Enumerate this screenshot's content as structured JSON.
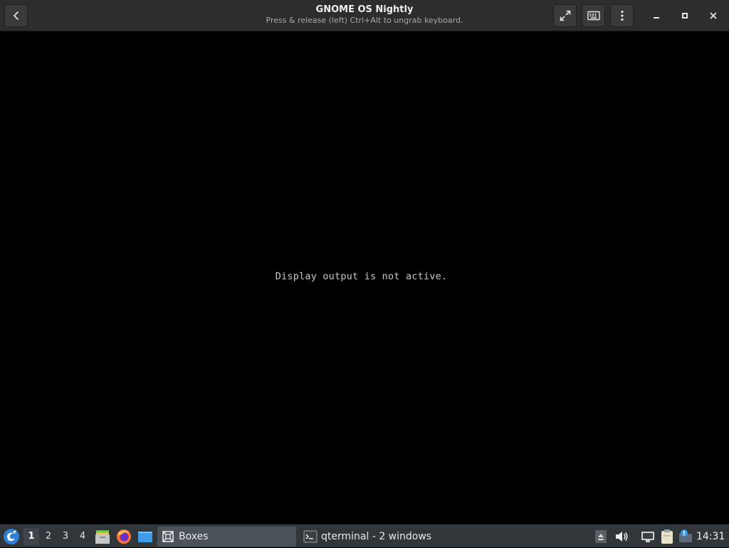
{
  "window": {
    "title": "GNOME OS Nightly",
    "subtitle": "Press & release (left) Ctrl+Alt to ungrab keyboard."
  },
  "display": {
    "message": "Display output is not active."
  },
  "taskbar": {
    "desktops": [
      "1",
      "2",
      "3",
      "4"
    ],
    "active_desktop": "1",
    "tasks": [
      {
        "label": "Boxes",
        "icon": "boxes-icon",
        "active": true
      },
      {
        "label": "qterminal - 2 windows",
        "icon": "terminal-icon",
        "active": false
      }
    ],
    "clock": "14:31"
  },
  "colors": {
    "headerbar": "#2d2d2d",
    "taskbar": "#31363b",
    "display_bg": "#000000",
    "accent_blue": "#3d9be9"
  }
}
